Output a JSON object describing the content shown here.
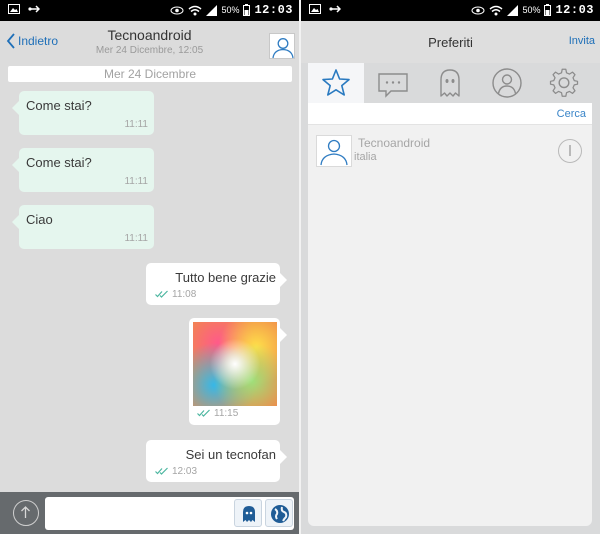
{
  "status_bar_left": {
    "clock": "12:03",
    "battery": "50%"
  },
  "status_bar_right": {
    "clock": "12:03",
    "battery": "50%"
  },
  "chat": {
    "back_label": "Indietro",
    "contact_name": "Tecnoandroid",
    "last_seen": "Mer 24 Dicembre, 12:05",
    "date_separator": "Mer 24 Dicembre",
    "messages": [
      {
        "direction": "in",
        "text": "Come stai?",
        "time": "11:11"
      },
      {
        "direction": "in",
        "text": "Come stai?",
        "time": "11:11"
      },
      {
        "direction": "in",
        "text": "Ciao",
        "time": "11:11"
      },
      {
        "direction": "out",
        "text": "Tutto bene grazie",
        "time": "11:08",
        "read": true
      },
      {
        "direction": "out",
        "type": "image",
        "time": "11:15",
        "read": true
      },
      {
        "direction": "out",
        "text": "Sei un tecnofan",
        "time": "12:03",
        "read": true
      }
    ],
    "input_value": "",
    "colors": {
      "accent": "#1e6fb8",
      "incoming_bubble": "#e5f6ee",
      "outgoing_bubble": "#ffffff",
      "read_ticks": "#4cb6a0"
    }
  },
  "favorites": {
    "title": "Preferiti",
    "invite_label": "Invita",
    "tabs": [
      {
        "name": "favorites",
        "icon": "star-icon",
        "active": true
      },
      {
        "name": "chats",
        "icon": "chat-bubble-icon",
        "active": false
      },
      {
        "name": "ghost",
        "icon": "ghost-icon",
        "active": false
      },
      {
        "name": "contacts",
        "icon": "user-circle-icon",
        "active": false
      },
      {
        "name": "settings",
        "icon": "gear-icon",
        "active": false
      }
    ],
    "search_label": "Cerca",
    "contacts": [
      {
        "name": "Tecnoandroid",
        "status": "italia"
      }
    ]
  }
}
